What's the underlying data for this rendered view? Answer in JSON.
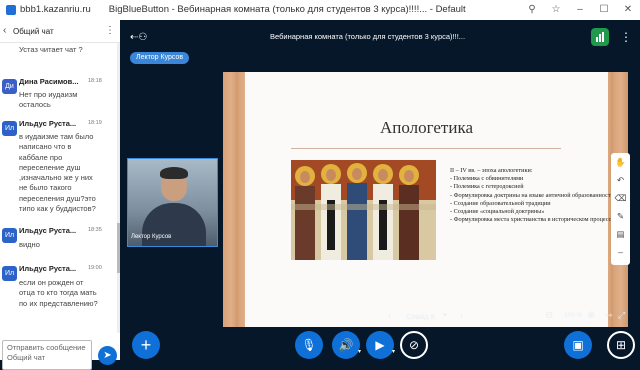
{
  "window": {
    "tab_label": "bbb1.kazanriu.ru",
    "title": "BigBlueButton - Вебинарная комната (только для студентов 3 курса)!!!!... - Default"
  },
  "chat": {
    "header": "Общий чат",
    "messages": [
      {
        "initials": "",
        "name": "",
        "time": "",
        "text": "Устаз читает чат ?",
        "color": "#2a6fd8"
      },
      {
        "initials": "Ди",
        "name": "Дина Расимов...",
        "time": "18:18",
        "text": "Нет про иудаизм осталось",
        "color": "#3b5fc7"
      },
      {
        "initials": "Ил",
        "name": "Ильдус Руста...",
        "time": "18:19",
        "text": "в иудаизме там было написано что в каббале про переселение душ ,изначально же у них не было такого переселения душ?это типо как у буддистов?",
        "color": "#2d63c9"
      },
      {
        "initials": "Ил",
        "name": "Ильдус Руста...",
        "time": "18:35",
        "text": "видно",
        "color": "#2d63c9"
      },
      {
        "initials": "Ил",
        "name": "Ильдус Руста...",
        "time": "19:00",
        "text": "если он рожден от отца то кто тогда мать по их представлению?",
        "color": "#2d63c9"
      }
    ],
    "input_placeholder": "Отправить сообщение Общий чат"
  },
  "header": {
    "meeting_title": "Вебинарная комната (только для студентов 3 курса)!!!..."
  },
  "presenter": {
    "label": "Лектор Курсов"
  },
  "webcam": {
    "name": "Лектор Курсов"
  },
  "slide": {
    "title": "Апологетика",
    "bullets": [
      "II – IV вв. – эпоха апологетики:",
      "-    Полемика с обвинителями",
      "-    Полемика с гетеродоксией",
      "-    Формулировка доктрины на языке античной образованности",
      "-    Создание образовательной традиции",
      "-    Создание «социальной доктрины»",
      "-    Формулировка места христианства в историческом процессе"
    ]
  },
  "pres_toolbar": {
    "slide_label": "Слайд 8",
    "zoom": "100 %"
  },
  "colors": {
    "accent": "#0f70d7",
    "background": "#06172a",
    "presenter_badge": "#3a86d8",
    "stats_green": "#1f9a4c"
  }
}
